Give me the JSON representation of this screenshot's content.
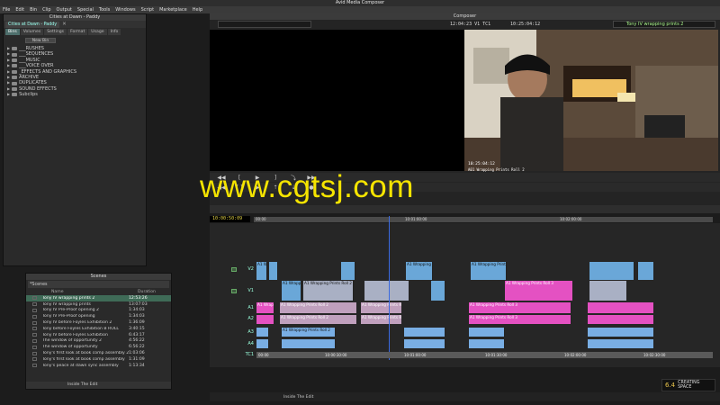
{
  "app_title": "Avid Media Composer",
  "menu": [
    "File",
    "Edit",
    "Bin",
    "Clip",
    "Output",
    "Special",
    "Tools",
    "Windows",
    "Script",
    "Marketplace",
    "Help"
  ],
  "bin_window": {
    "title": "Cities at Dawn - Paddy",
    "tab": "Cities at Dawn - Paddy",
    "subtabs": [
      "Bins",
      "Volumes",
      "Settings",
      "Format",
      "Usage",
      "Info"
    ],
    "new_bin": "New Bin",
    "items": [
      "___RUSHES",
      "___SEQUENCES",
      "___MUSIC",
      "___VOICE OVER",
      "_EFFECTS AND GRAPHICS",
      "ARCHIVE",
      "DUPLICATES",
      "SOUND EFFECTS",
      "Subclips"
    ]
  },
  "composer": {
    "title": "Composer",
    "tc_left": "12:04:23",
    "tc_label": "V1 TC1",
    "tc_right": "10:25:04:12",
    "record_clip": "Tony IV wrapping prints 2",
    "overlay_tc": "10:25:04:12",
    "overlay_clip": "A01 Wrapping Prints Roll 2"
  },
  "timeline": {
    "timecode": "10:00:50:09",
    "ruler_top": [
      "00:00",
      "10:01:00:00",
      "10:02:00:00"
    ],
    "ruler_bottom": [
      "00:00",
      "10:00:30:00",
      "10:01:00:00",
      "10:01:30:00",
      "10:02:00:00",
      "10:02:30:00"
    ],
    "tracks": [
      "V2",
      "V1",
      "A1",
      "A2",
      "A3",
      "A4",
      "TC1"
    ],
    "clip_label": "A1 Wrapping Prints Roll 2",
    "clip_label_v": "A1 Wrapping Prints Roll 2",
    "clip_label_a3": "A1 Wrapping Prints Roll 3",
    "status": "Inside The Edit"
  },
  "scenes": {
    "title": "Scenes",
    "tab": "*Scenes",
    "col_name": "Name",
    "col_duration": "Duration",
    "rows": [
      {
        "name": "Tony IV wrapping prints 2",
        "duration": "12:53:26"
      },
      {
        "name": "Tony IV wrapping prints",
        "duration": "13:07:03"
      },
      {
        "name": "Tony IV Pre-Proof opening 2",
        "duration": "1:34:03"
      },
      {
        "name": "Tony IV Pre-Proof opening",
        "duration": "1:34:03"
      },
      {
        "name": "Tony IV before Foyles Exhibition 2",
        "duration": "1:36:09"
      },
      {
        "name": "Tony before Foyles Exhibition B ROLL",
        "duration": "3:40:15"
      },
      {
        "name": "Tony IV before Foyles Exhibition",
        "duration": "6:43:17"
      },
      {
        "name": "The window of opportunity 2",
        "duration": "4:56:22"
      },
      {
        "name": "The window of opportunity",
        "duration": "6:56:22"
      },
      {
        "name": "Tony's first look at book comp assembly 2",
        "duration": "1:03:06"
      },
      {
        "name": "Tony's first look at book comp assembly",
        "duration": "1:31:09"
      },
      {
        "name": "Tony's peace at dawn sync assembly",
        "duration": "1:13:34"
      }
    ],
    "footer": "Inside The Edit"
  },
  "watermark": "www.cgtsj.com",
  "logo": {
    "mark": "6.4",
    "text": "CREATING SPACE"
  },
  "colors": {
    "video_clip": "#6aa7d8",
    "audio_clip": "#e451c2",
    "selected": "#3f6b57",
    "watermark": "#f5e400"
  }
}
